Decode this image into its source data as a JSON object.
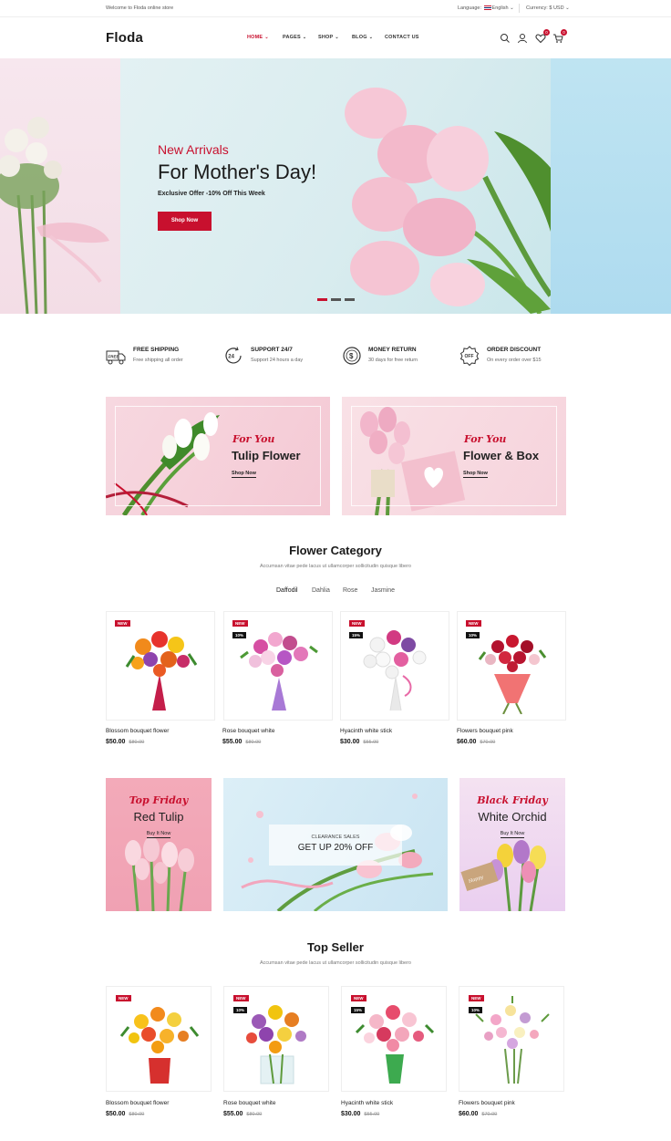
{
  "topbar": {
    "welcome": "Welcome to Floda online store",
    "language_label": "Language:",
    "language_value": "English",
    "currency_label": "Currency:",
    "currency_value": "$ USD"
  },
  "header": {
    "logo": "Floda",
    "nav": [
      "HOME",
      "PAGES",
      "SHOP",
      "BLOG",
      "CONTACT US"
    ],
    "wishlist_count": "0",
    "cart_count": "0"
  },
  "hero": {
    "subtitle": "New Arrivals",
    "title": "For Mother's Day!",
    "offer": "Exclusive Offer -10% Off This Week",
    "button": "Shop Now"
  },
  "features": [
    {
      "icon": "free-shipping-truck-icon",
      "title": "FREE SHIPPING",
      "desc": "Free shipping all order"
    },
    {
      "icon": "support-24-7-icon",
      "title": "SUPPORT 24/7",
      "desc": "Support 24 hours a day"
    },
    {
      "icon": "money-return-icon",
      "title": "MONEY RETURN",
      "desc": "30 days for free return"
    },
    {
      "icon": "order-discount-icon",
      "title": "ORDER DISCOUNT",
      "desc": "On every order over $15"
    }
  ],
  "promos": [
    {
      "script": "For You",
      "title": "Tulip Flower",
      "link": "Shop Now"
    },
    {
      "script": "For You",
      "title": "Flower & Box",
      "link": "Shop Now"
    }
  ],
  "category": {
    "title": "Flower Category",
    "subtitle": "Accumsan vitae pede lacus ut ullamcorper sollicitudin quisque libero",
    "tabs": [
      "Daffodil",
      "Dahlia",
      "Rose",
      "Jasmine"
    ],
    "products": [
      {
        "name": "Blossom bouquet flower",
        "price": "$50.00",
        "old": "$80.00",
        "new_badge": "NEW",
        "off_badge": ""
      },
      {
        "name": "Rose bouquet white",
        "price": "$55.00",
        "old": "$80.00",
        "new_badge": "NEW",
        "off_badge": "10%"
      },
      {
        "name": "Hyacinth white stick",
        "price": "$30.00",
        "old": "$55.00",
        "new_badge": "NEW",
        "off_badge": "15%"
      },
      {
        "name": "Flowers bouquet pink",
        "price": "$60.00",
        "old": "$70.00",
        "new_badge": "NEW",
        "off_badge": "10%"
      }
    ]
  },
  "deals": {
    "left": {
      "script": "Top Friday",
      "title": "Red Tulip",
      "link": "Buy It Now"
    },
    "center": {
      "label": "CLEARANCE SALES",
      "title": "GET UP 20% OFF"
    },
    "right": {
      "script": "Black Friday",
      "title": "White Orchid",
      "link": "Buy It Now"
    }
  },
  "topseller": {
    "title": "Top Seller",
    "subtitle": "Accumsan vitae pede lacus ut ullamcorper sollicitudin quisque libero",
    "products": [
      {
        "name": "Blossom bouquet flower",
        "price": "$50.00",
        "old": "$80.00",
        "new_badge": "NEW",
        "off_badge": ""
      },
      {
        "name": "Rose bouquet white",
        "price": "$55.00",
        "old": "$80.00",
        "new_badge": "NEW",
        "off_badge": "10%"
      },
      {
        "name": "Hyacinth white stick",
        "price": "$30.00",
        "old": "$55.00",
        "new_badge": "NEW",
        "off_badge": "15%"
      },
      {
        "name": "Flowers bouquet pink",
        "price": "$60.00",
        "old": "$70.00",
        "new_badge": "NEW",
        "off_badge": "10%"
      }
    ]
  },
  "colors": {
    "accent": "#c8102e",
    "dark": "#1a1a1a"
  }
}
